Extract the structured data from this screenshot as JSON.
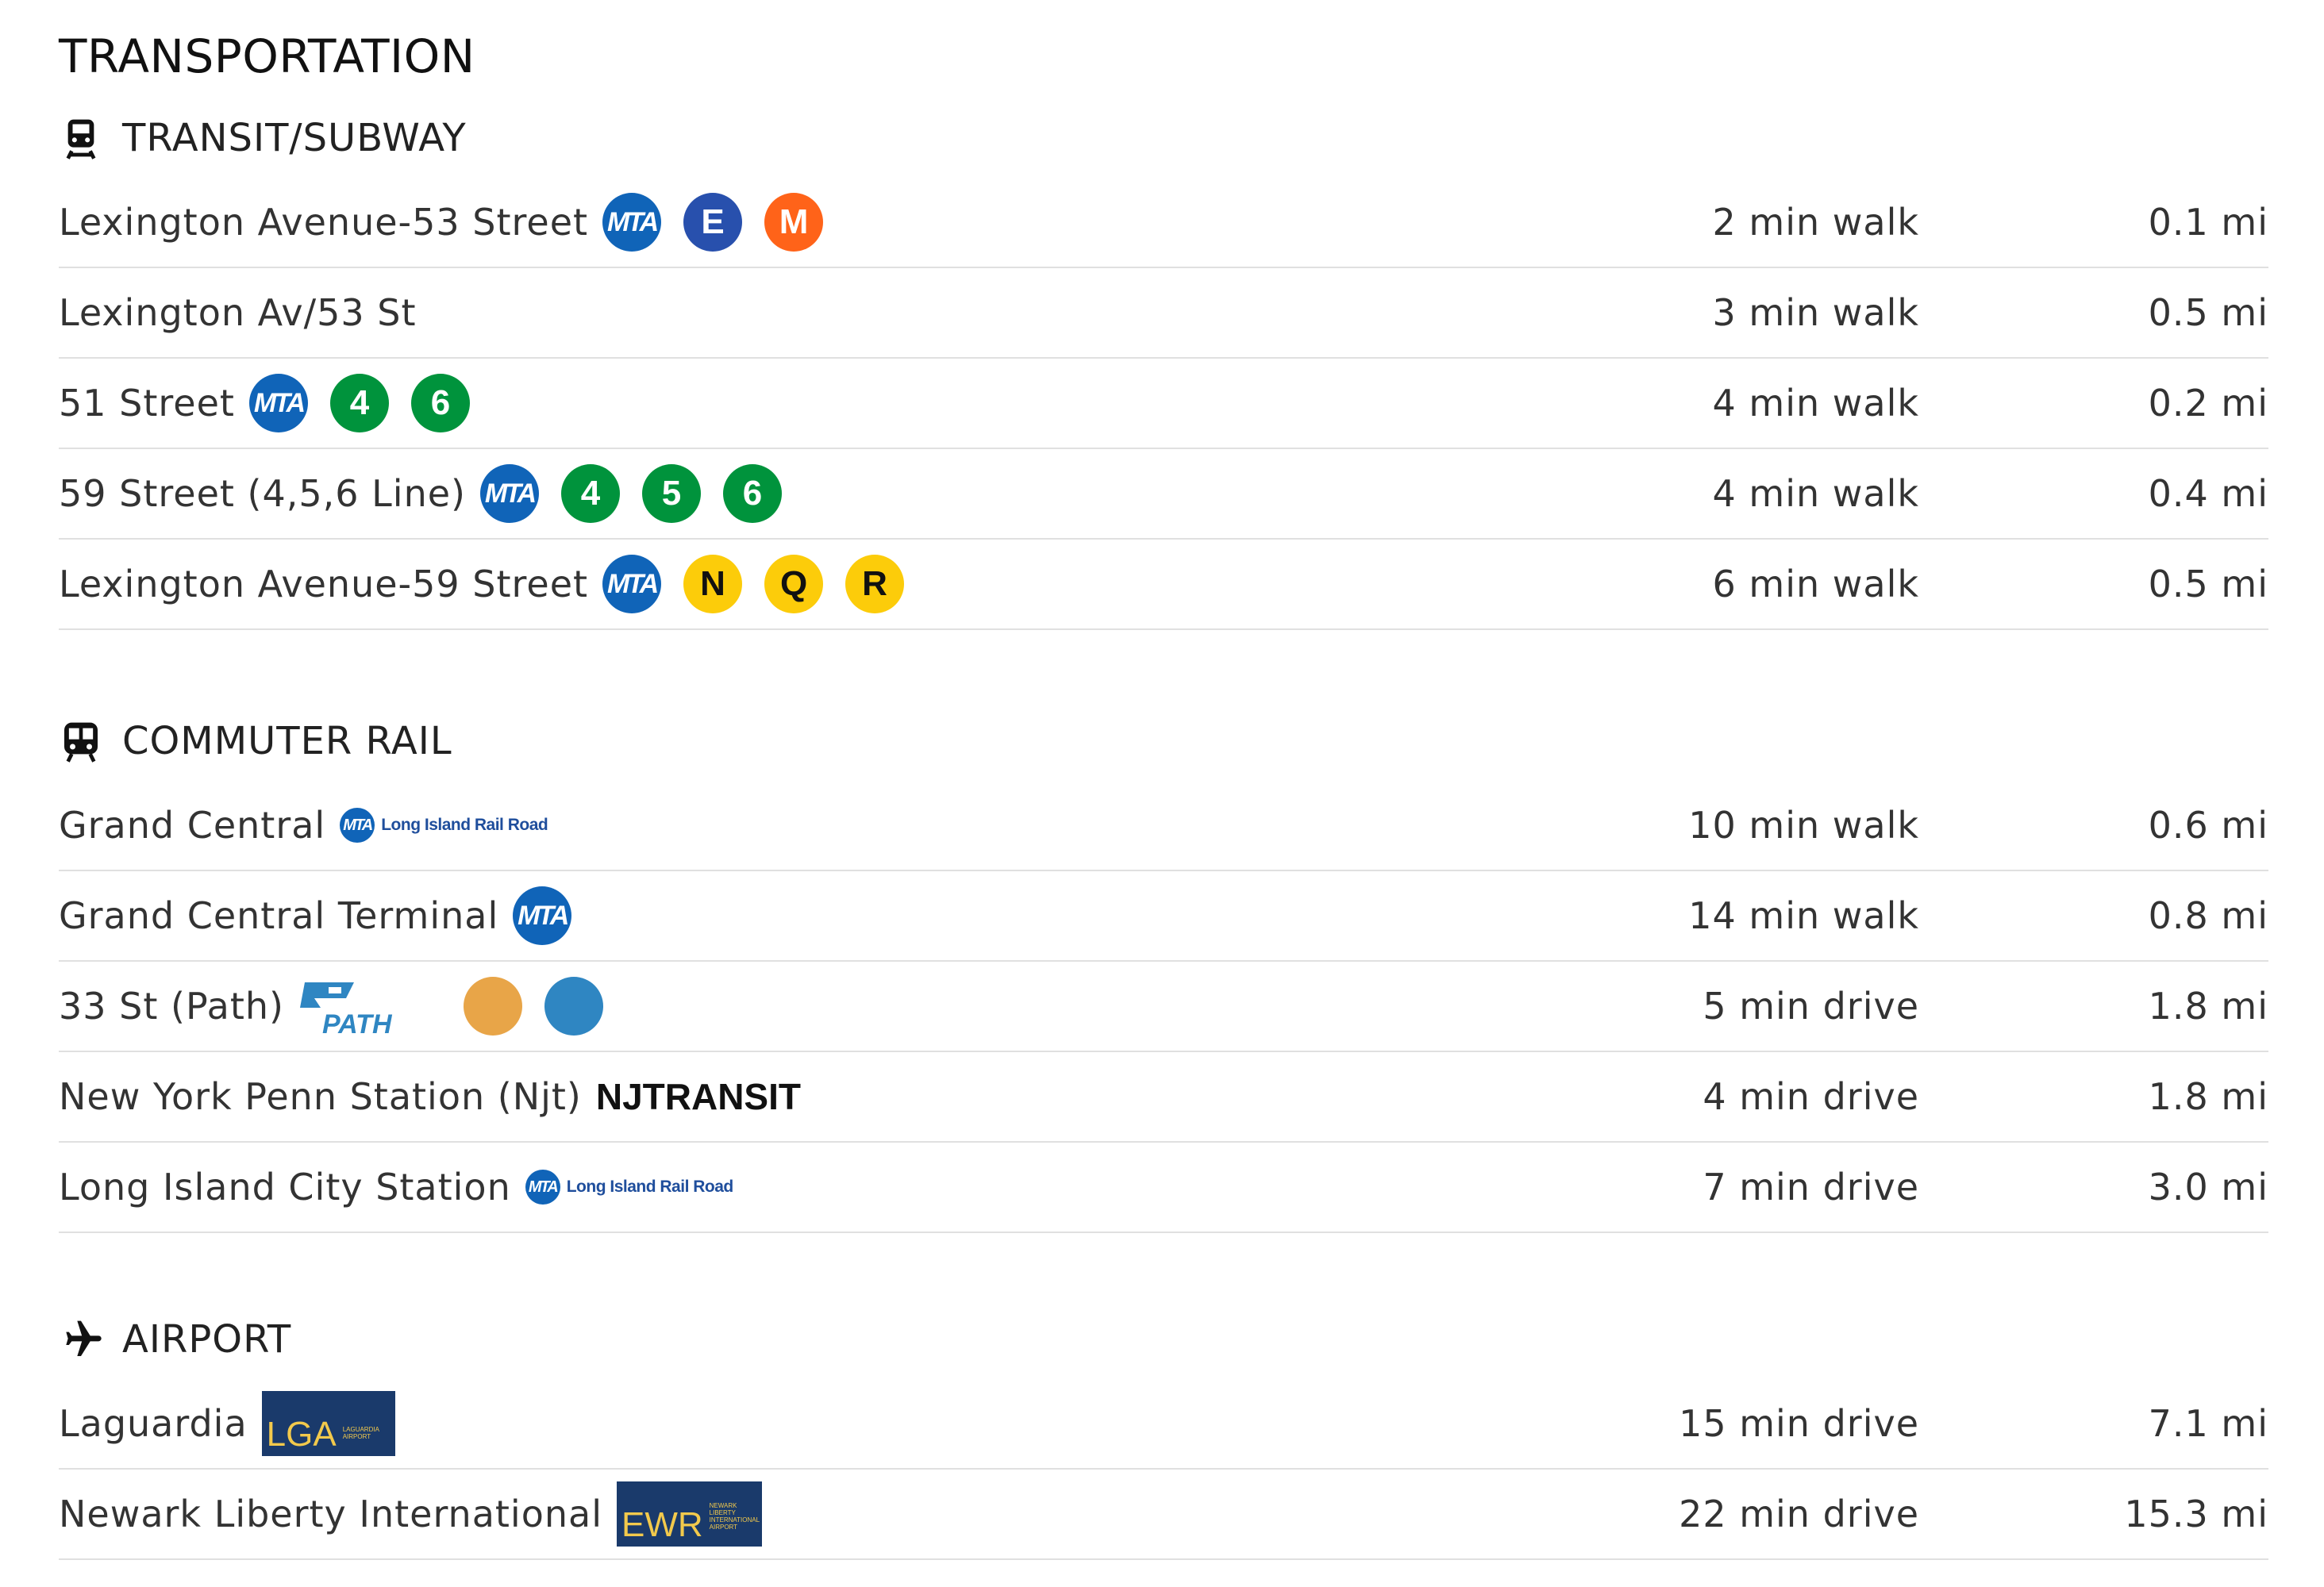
{
  "page": {
    "title": "TRANSPORTATION"
  },
  "colors": {
    "mta_blue": "#1064b8",
    "line_E": "#2850ad",
    "line_M": "#ff6319",
    "line_green": "#00933c",
    "line_yellow": "#fccc0a",
    "path_orange": "#e8a548",
    "path_blue": "#2f86c2",
    "airport_navy": "#1a3a6b",
    "airport_gold": "#f2c94c"
  },
  "sections": {
    "transit": {
      "title": "TRANSIT/SUBWAY",
      "icon": "train-front-icon",
      "rows": [
        {
          "name": "Lexington Avenue-53 Street",
          "mta": "MTA",
          "lines": [
            "E",
            "M"
          ],
          "time": "2 min walk",
          "distance": "0.1 mi"
        },
        {
          "name": "Lexington Av/53 St",
          "time": "3 min walk",
          "distance": "0.5 mi"
        },
        {
          "name": "51 Street",
          "mta": "MTA",
          "lines": [
            "4",
            "6"
          ],
          "time": "4 min walk",
          "distance": "0.2 mi"
        },
        {
          "name": "59 Street (4,5,6 Line)",
          "mta": "MTA",
          "lines": [
            "4",
            "5",
            "6"
          ],
          "time": "4 min walk",
          "distance": "0.4 mi"
        },
        {
          "name": "Lexington Avenue-59 Street",
          "mta": "MTA",
          "lines": [
            "N",
            "Q",
            "R"
          ],
          "time": "6 min walk",
          "distance": "0.5 mi"
        }
      ]
    },
    "rail": {
      "title": "COMMUTER RAIL",
      "icon": "commuter-train-icon",
      "rows": [
        {
          "name": "Grand Central",
          "mta": "MTA",
          "logo_text": "Long Island Rail Road",
          "time": "10 min walk",
          "distance": "0.6 mi"
        },
        {
          "name": "Grand Central Terminal",
          "mta": "MTA",
          "time": "14 min walk",
          "distance": "0.8 mi"
        },
        {
          "name": "33 St (Path)",
          "logo_text": "PATH",
          "time": "5 min drive",
          "distance": "1.8 mi"
        },
        {
          "name": "New York Penn Station (Njt)",
          "logo_text": "NJTRANSIT",
          "time": "4 min drive",
          "distance": "1.8 mi"
        },
        {
          "name": "Long Island City Station",
          "mta": "MTA",
          "logo_text": "Long Island Rail Road",
          "time": "7 min drive",
          "distance": "3.0 mi"
        }
      ]
    },
    "airport": {
      "title": "AIRPORT",
      "icon": "airplane-icon",
      "rows": [
        {
          "name": "Laguardia",
          "logo_code": "LGA",
          "logo_sub": "LAGUARDIA AIRPORT",
          "time": "15 min drive",
          "distance": "7.1 mi"
        },
        {
          "name": "Newark Liberty International",
          "logo_code": "EWR",
          "logo_sub": "NEWARK LIBERTY INTERNATIONAL AIRPORT",
          "time": "22 min drive",
          "distance": "15.3 mi"
        }
      ]
    }
  }
}
